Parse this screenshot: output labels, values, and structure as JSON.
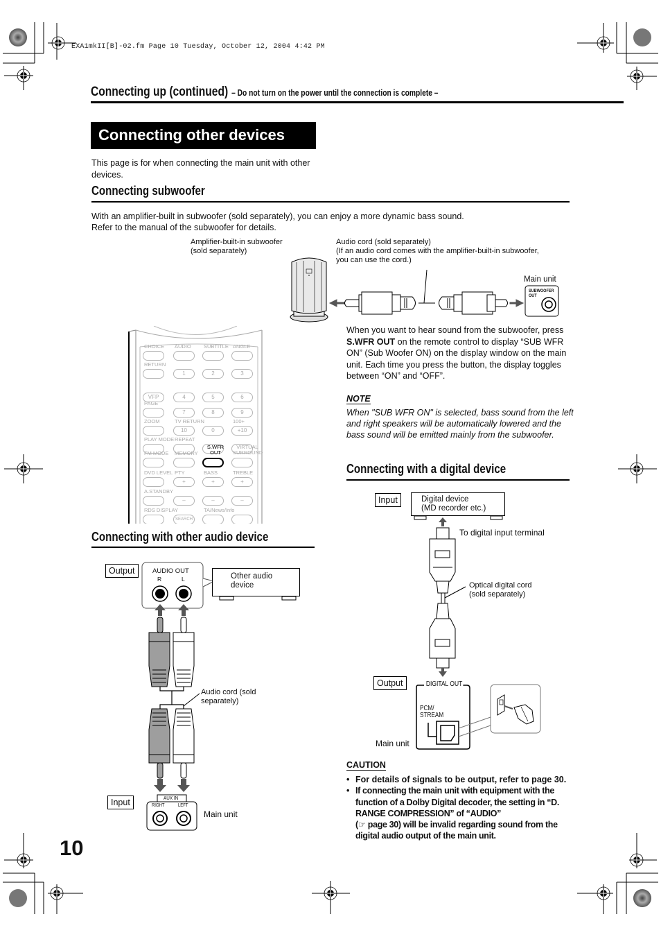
{
  "file_header": "EXA1mkII[B]-02.fm  Page 10  Tuesday, October 12, 2004  4:42 PM",
  "section": {
    "title": "Connecting up (continued)",
    "subtitle": "– Do not turn on the power until the connection is complete –"
  },
  "page_title": "Connecting other devices",
  "intro": "This page is for when connecting the main unit with other devices.",
  "subwoofer": {
    "heading": "Connecting subwoofer",
    "text_line1": "With an amplifier-built in subwoofer (sold separately), you can enjoy a more dynamic bass sound.",
    "text_line2": "Refer to the manual of the subwoofer for details.",
    "label_subwoofer_1": "Amplifier-built-in subwoofer",
    "label_subwoofer_2": "(sold separately)",
    "label_cord_1": "Audio cord (sold separately)",
    "label_cord_2": "(If an audio cord comes with the amplifier-built-in subwoofer,",
    "label_cord_3": "you can use the cord.)",
    "label_main_unit": "Main unit",
    "jack_label_1": "SUBWOOFER",
    "jack_label_2": "OUT",
    "body_pre": "When you want to hear sound from the subwoofer, press ",
    "body_bold": "S.WFR OUT",
    "body_post": " on the remote control to display “SUB WFR ON” (Sub Woofer ON) on the display window on the main unit. Each time you press the button, the display toggles between “ON” and “OFF”.",
    "note_heading": "NOTE",
    "note_text": "When \"SUB WFR ON\" is selected, bass sound from the left and right speakers will be automatically lowered and the bass sound will be emitted mainly from the subwoofer."
  },
  "remote": {
    "rows": [
      {
        "labels": [
          "CHOICE",
          "AUDIO",
          "SUBTITLE",
          "ANGLE"
        ],
        "buttons": [
          "",
          "",
          "",
          ""
        ]
      },
      {
        "labels": [
          "RETURN",
          "",
          "",
          ""
        ],
        "buttons": [
          "",
          "1",
          "2",
          "3"
        ]
      },
      {
        "labels": [
          "",
          "",
          "",
          ""
        ],
        "buttons": [
          "VFP",
          "4",
          "5",
          "6"
        ]
      },
      {
        "labels": [
          "PAGE",
          "",
          "",
          ""
        ],
        "buttons": [
          "",
          "7",
          "8",
          "9"
        ]
      },
      {
        "labels": [
          "ZOOM",
          "TV RETURN",
          "",
          "100+"
        ],
        "buttons": [
          "",
          "10",
          "0",
          "+10"
        ]
      },
      {
        "labels": [
          "PLAY MODE",
          "REPEAT",
          "",
          ""
        ],
        "buttons": [
          "",
          "",
          "",
          ""
        ]
      },
      {
        "labels": [
          "FM MODE",
          "MEMORY",
          "S.WFR OUT",
          "VIRTUAL SURROUND"
        ],
        "buttons": [
          "",
          "",
          "",
          ""
        ]
      },
      {
        "labels": [
          "DVD LEVEL",
          "PTY",
          "BASS",
          "TREBLE"
        ],
        "buttons": [
          "",
          "+",
          "+",
          "+"
        ]
      },
      {
        "labels": [
          "A.STANDBY",
          "",
          "",
          ""
        ],
        "buttons": [
          "",
          "–",
          "–",
          "–"
        ]
      },
      {
        "labels": [
          "RDS DISPLAY",
          "",
          "TA/News/Info",
          ""
        ],
        "buttons": [
          "",
          "SEARCH",
          "",
          ""
        ]
      }
    ],
    "highlighted": "S.WFR OUT"
  },
  "audio_device": {
    "heading": "Connecting with other audio device",
    "output_label": "Output",
    "jack_title": "AUDIO OUT",
    "jack_r": "R",
    "jack_l": "L",
    "device_label_1": "Other audio",
    "device_label_2": "device",
    "cord_label_1": "Audio cord (sold",
    "cord_label_2": "separately)",
    "input_label": "Input",
    "aux_title": "AUX IN",
    "aux_right": "RIGHT",
    "aux_left": "LEFT",
    "main_unit": "Main unit"
  },
  "digital_device": {
    "heading": "Connecting with a digital device",
    "input_label": "Input",
    "device_label_1": "Digital device",
    "device_label_2": "(MD recorder etc.)",
    "to_terminal": "To digital input terminal",
    "cord_label_1": "Optical digital cord",
    "cord_label_2": "(sold separately)",
    "output_label": "Output",
    "jack_title": "DIGITAL OUT",
    "jack_sub_1": "PCM/",
    "jack_sub_2": "STREAM",
    "main_unit": "Main unit"
  },
  "caution": {
    "heading": "CAUTION",
    "item1": "For details of signals to be output, refer to page 30.",
    "item2_a": "If connecting the main unit with equipment with the function of a Dolby Digital decoder, the setting in “D. RANGE COMPRESSION” of “AUDIO”",
    "item2_icon": "☞",
    "item2_b": " page 30) will be invalid regarding sound from the digital audio output of the main unit."
  },
  "page_number": "10",
  "colors": {
    "title_bg": "#000000",
    "plug_gray": "#9e9e9e",
    "arrow_gray": "#555555",
    "remote_faint": "#aaaaaa"
  }
}
